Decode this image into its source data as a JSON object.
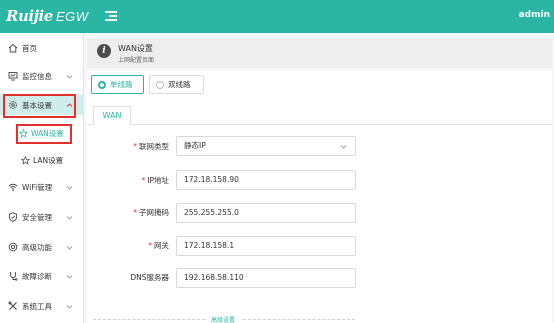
{
  "header": {
    "logo": "Ruijie",
    "product": "EGW",
    "user_text": "admin"
  },
  "sidebar": {
    "items": [
      {
        "label": "首页",
        "icon": "home-icon"
      },
      {
        "label": "监控信息",
        "icon": "monitor-icon"
      },
      {
        "label": "基本设置",
        "icon": "settings-icon"
      },
      {
        "label": "WiFi管理",
        "icon": "wifi-icon"
      },
      {
        "label": "安全管理",
        "icon": "shield-icon"
      },
      {
        "label": "高级功能",
        "icon": "advanced-icon"
      },
      {
        "label": "故障诊断",
        "icon": "diagnosis-icon"
      },
      {
        "label": "系统工具",
        "icon": "tools-icon"
      }
    ],
    "sub_items": [
      {
        "label": "WAN设置",
        "icon": "star-icon"
      },
      {
        "label": "LAN设置",
        "icon": "star-icon"
      }
    ]
  },
  "page": {
    "title": "WAN设置",
    "subtitle": "上网配置页面"
  },
  "line_mode": {
    "single": "单线路",
    "dual": "双线路",
    "selected": "单线路"
  },
  "tabs": [
    "WAN"
  ],
  "form": {
    "conn_type_label": "联网类型",
    "conn_type_value": "静态IP",
    "ip_label": "IP地址",
    "ip_value": "172.18.158.90",
    "mask_label": "子网掩码",
    "mask_value": "255.255.255.0",
    "gateway_label": "网关",
    "gateway_value": "172.18.158.1",
    "dns_label": "DNS服务器",
    "dns_value": "192.168.58.110",
    "required_mark": "*"
  },
  "advanced": "高级设置",
  "colors": {
    "accent": "#2bb5a3",
    "highlight_box": "#e0322c",
    "active_bg": "#cfeee9"
  }
}
